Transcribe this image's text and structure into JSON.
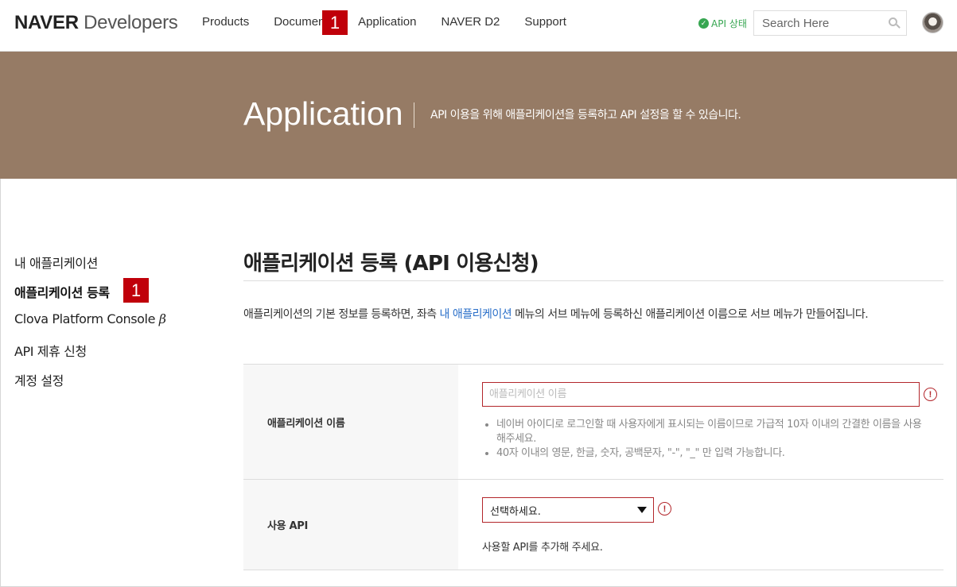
{
  "header": {
    "logo_bold": "NAVER",
    "logo_light": "Developers",
    "nav": [
      "Products",
      "Documents",
      "Application",
      "NAVER D2",
      "Support"
    ],
    "api_status": "API 상태",
    "search_placeholder": "Search Here"
  },
  "badges": {
    "top": "1",
    "sidebar": "1"
  },
  "banner": {
    "title": "Application",
    "description": "API 이용을 위해 애플리케이션을 등록하고 API 설정을 할 수 있습니다."
  },
  "sidebar": {
    "items": [
      "내 애플리케이션",
      "애플리케이션 등록",
      "Clova Platform Console",
      "API 제휴 신청",
      "계정 설정"
    ],
    "beta_symbol": "β"
  },
  "main": {
    "title": "애플리케이션 등록 (API 이용신청)",
    "intro_before": "애플리케이션의 기본 정보를 등록하면, 좌측 ",
    "intro_link": "내 애플리케이션",
    "intro_after": " 메뉴의 서브 메뉴에 등록하신 애플리케이션 이름으로 서브 메뉴가 만들어집니다."
  },
  "form": {
    "app_name_label": "애플리케이션 이름",
    "app_name_placeholder": "애플리케이션 이름",
    "app_name_hints": [
      "네이버 아이디로 로그인할 때 사용자에게 표시되는 이름이므로 가급적 10자 이내의 간결한 이름을 사용해주세요.",
      "40자 이내의 영문, 한글, 숫자, 공백문자, \"-\", \"_\" 만 입력 가능합니다."
    ],
    "api_label": "사용 API",
    "api_select_value": "선택하세요.",
    "api_note": "사용할 API를 추가해 주세요.",
    "warn_symbol": "!"
  }
}
